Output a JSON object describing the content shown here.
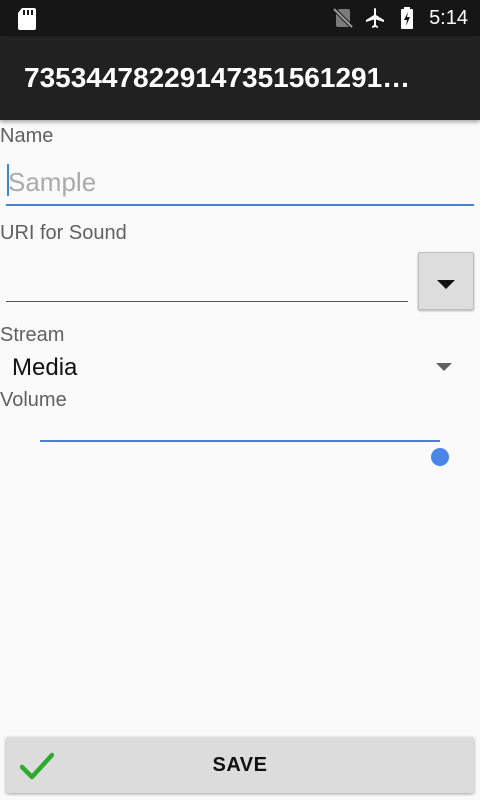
{
  "status_bar": {
    "time": "5:14",
    "icons": [
      "sd-card-icon",
      "no-sim-icon",
      "airplane-mode-icon",
      "battery-charging-icon"
    ]
  },
  "app_bar": {
    "title": "73534478229147351561291…"
  },
  "form": {
    "name": {
      "label": "Name",
      "value": "",
      "placeholder": "Sample"
    },
    "uri": {
      "label": "URI for Sound",
      "value": ""
    },
    "stream": {
      "label": "Stream",
      "selected": "Media"
    },
    "volume": {
      "label": "Volume",
      "level": 1.0
    }
  },
  "save_button": {
    "label": "SAVE",
    "icon": "checkmark-icon"
  },
  "colors": {
    "accent": "#4a7fd4",
    "app_bar": "#212121",
    "status_bar": "#161616",
    "background": "#fafafa",
    "check_green": "#2eaa2e"
  }
}
